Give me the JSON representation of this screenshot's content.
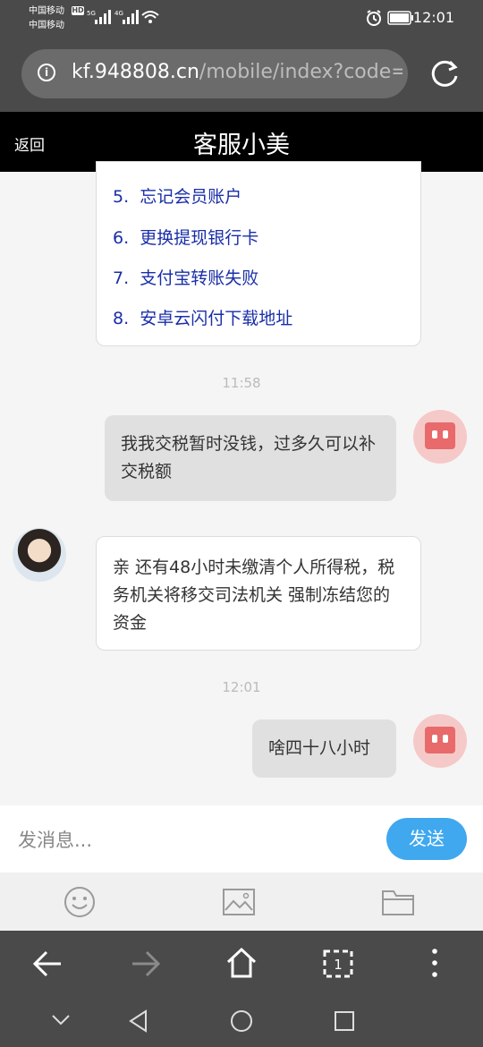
{
  "status_bar": {
    "carrier1": "中国移动",
    "carrier2": "中国移动",
    "network1": "5G",
    "network2": "4G",
    "time": "12:01"
  },
  "browser": {
    "url_host": "kf.948808.cn",
    "url_path": "/mobile/index?code="
  },
  "header": {
    "back_label": "返回",
    "title": "客服小美"
  },
  "chat": {
    "menu_items": [
      {
        "num": "5.",
        "text": "忘记会员账户"
      },
      {
        "num": "6.",
        "text": "更换提现银行卡"
      },
      {
        "num": "7.",
        "text": "支付宝转账失败"
      },
      {
        "num": "8.",
        "text": "安卓云闪付下载地址"
      }
    ],
    "ts1": "11:58",
    "user_msg1": "我我交税暂时没钱，过多久可以补交税额",
    "agent_msg": "亲  还有48小时未缴清个人所得税，税务机关将移交司法机关  强制冻结您的资金",
    "ts2": "12:01",
    "user_msg2": "啥四十八小时"
  },
  "composer": {
    "placeholder": "发消息...",
    "send_label": "发送"
  },
  "icons": {
    "emoji": "emoji-icon",
    "image": "image-icon",
    "folder": "folder-icon"
  },
  "colors": {
    "send": "#3fa8ef",
    "link": "#1a2ea8",
    "user_avatar": "#e86a6a"
  }
}
